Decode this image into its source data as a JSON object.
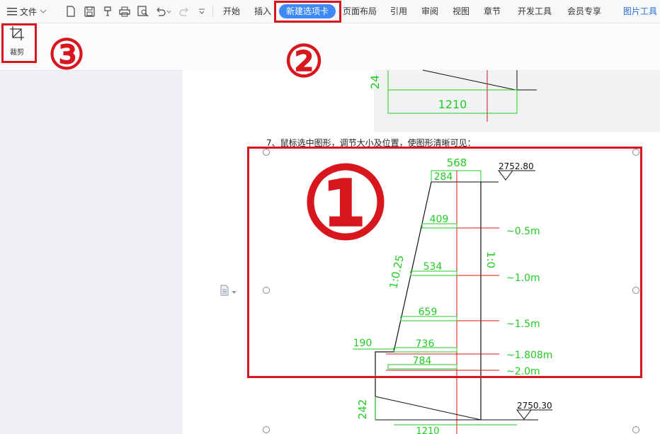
{
  "menu": {
    "file_label": "文件"
  },
  "tabs": [
    "开始",
    "插入",
    "新建选项卡",
    "页面布局",
    "引用",
    "审阅",
    "视图",
    "章节",
    "开发工具",
    "会员专享",
    "图片工具"
  ],
  "active_tab": "新建选项卡",
  "ribbon": {
    "crop_label": "裁剪"
  },
  "document": {
    "caption": "7、鼠标选中图形，调节大小及位置，使图形清晰可见："
  },
  "drawing_top": {
    "dim_width": "1210",
    "dim_height": "24"
  },
  "drawing_main": {
    "top_width": "568",
    "crest_width": "284",
    "elev_top": "2752.80",
    "elev_bottom": "2750.30",
    "slope_left": "1:0.25",
    "slope_right": "1:0",
    "left_step": "190",
    "bottom_height": "242",
    "bottom_width": "1210",
    "sections": [
      {
        "width": "409",
        "depth": "~0.5m"
      },
      {
        "width": "534",
        "depth": "~1.0m"
      },
      {
        "width": "659",
        "depth": "~1.5m"
      },
      {
        "width": "736",
        "depth": "~1.808m"
      },
      {
        "width": "784",
        "depth": "~2.0m"
      }
    ]
  },
  "annotations": {
    "m1": "①",
    "m2": "②",
    "m3": "③"
  },
  "colors": {
    "highlight": "#d8161d",
    "active_tab_bg": "#3d8af7",
    "cad_green": "#22cc22",
    "cad_red": "#d8161d"
  }
}
